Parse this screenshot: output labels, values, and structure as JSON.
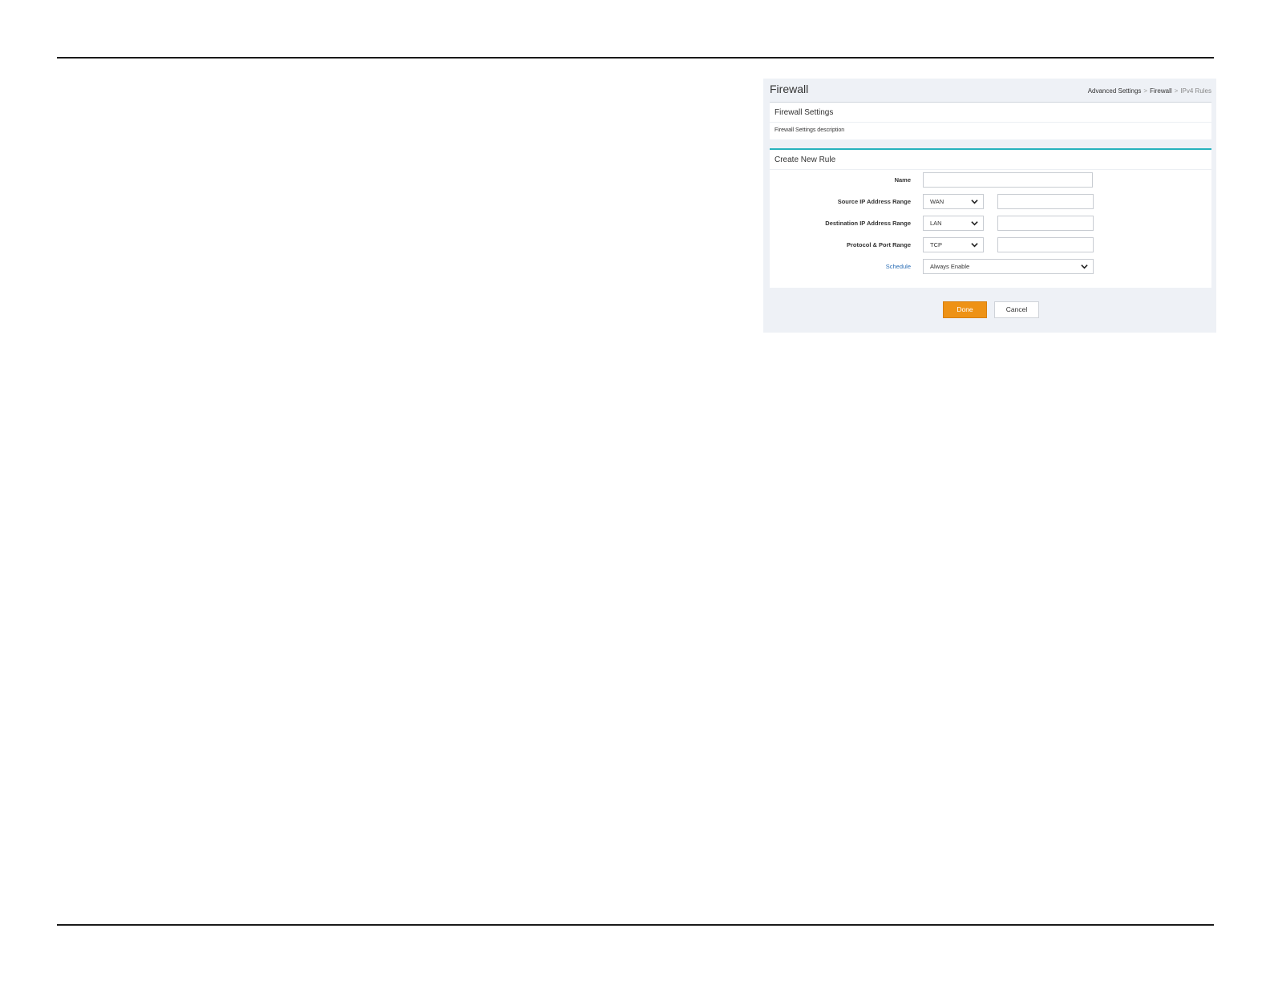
{
  "header": {
    "title": "Firewall",
    "breadcrumb": {
      "items": [
        "Advanced Settings",
        "Firewall",
        "IPv4 Rules"
      ],
      "separator": ">"
    }
  },
  "firewall_settings": {
    "title": "Firewall Settings",
    "description": "Firewall Settings description"
  },
  "create_rule": {
    "title": "Create New Rule",
    "name": {
      "label": "Name",
      "value": "",
      "placeholder": ""
    },
    "source_ip": {
      "label": "Source IP Address Range",
      "select_value": "WAN",
      "input_value": ""
    },
    "destination_ip": {
      "label": "Destination IP Address Range",
      "select_value": "LAN",
      "input_value": ""
    },
    "protocol": {
      "label": "Protocol & Port Range",
      "select_value": "TCP",
      "input_value": ""
    },
    "schedule": {
      "label": "Schedule",
      "select_value": "Always Enable"
    }
  },
  "actions": {
    "done_label": "Done",
    "cancel_label": "Cancel"
  },
  "colors": {
    "accent_teal": "#27b3bd",
    "primary_orange": "#ee9215",
    "link_blue": "#2a6db5",
    "panel_bg": "#eef1f6"
  },
  "icons": {
    "select_arrow": "chevron-down-icon"
  }
}
